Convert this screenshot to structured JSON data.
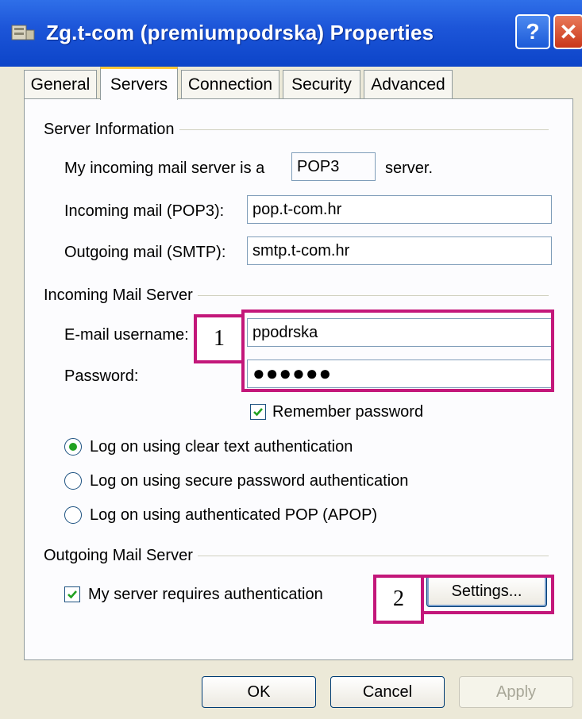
{
  "window": {
    "title": "Zg.t-com (premiumpodrska) Properties",
    "help_glyph": "?",
    "close_glyph": "✕"
  },
  "tabs": [
    {
      "label": "General",
      "active": false
    },
    {
      "label": "Servers",
      "active": true
    },
    {
      "label": "Connection",
      "active": false
    },
    {
      "label": "Security",
      "active": false
    },
    {
      "label": "Advanced",
      "active": false
    }
  ],
  "server_info": {
    "group_label": "Server Information",
    "incoming_type_prefix": "My incoming mail server is a",
    "incoming_type_value": "POP3",
    "incoming_type_suffix": "server.",
    "incoming_label": "Incoming mail (POP3):",
    "incoming_value": "pop.t-com.hr",
    "outgoing_label": "Outgoing mail (SMTP):",
    "outgoing_value": "smtp.t-com.hr"
  },
  "incoming_server": {
    "group_label": "Incoming Mail Server",
    "username_label": "E-mail username:",
    "username_value": "ppodrska",
    "password_label": "Password:",
    "password_mask": "●●●●●●",
    "remember_label": "Remember password",
    "remember_checked": true,
    "auth_options": [
      {
        "label": "Log on using clear text authentication",
        "selected": true
      },
      {
        "label": "Log on using secure password authentication",
        "selected": false
      },
      {
        "label": "Log on using authenticated POP (APOP)",
        "selected": false
      }
    ]
  },
  "outgoing_server": {
    "group_label": "Outgoing Mail Server",
    "requires_auth_label": "My server requires authentication",
    "requires_auth_checked": true,
    "settings_label": "Settings..."
  },
  "annotations": {
    "marker_1": "1",
    "marker_2": "2",
    "color": "#c3177a"
  },
  "footer": {
    "ok_label": "OK",
    "cancel_label": "Cancel",
    "apply_label": "Apply"
  },
  "colors": {
    "titlebar": "#0c44c8",
    "dialog_bg": "#ece9d8",
    "tab_highlight": "#ffc83c",
    "radio_dot": "#21a121"
  }
}
